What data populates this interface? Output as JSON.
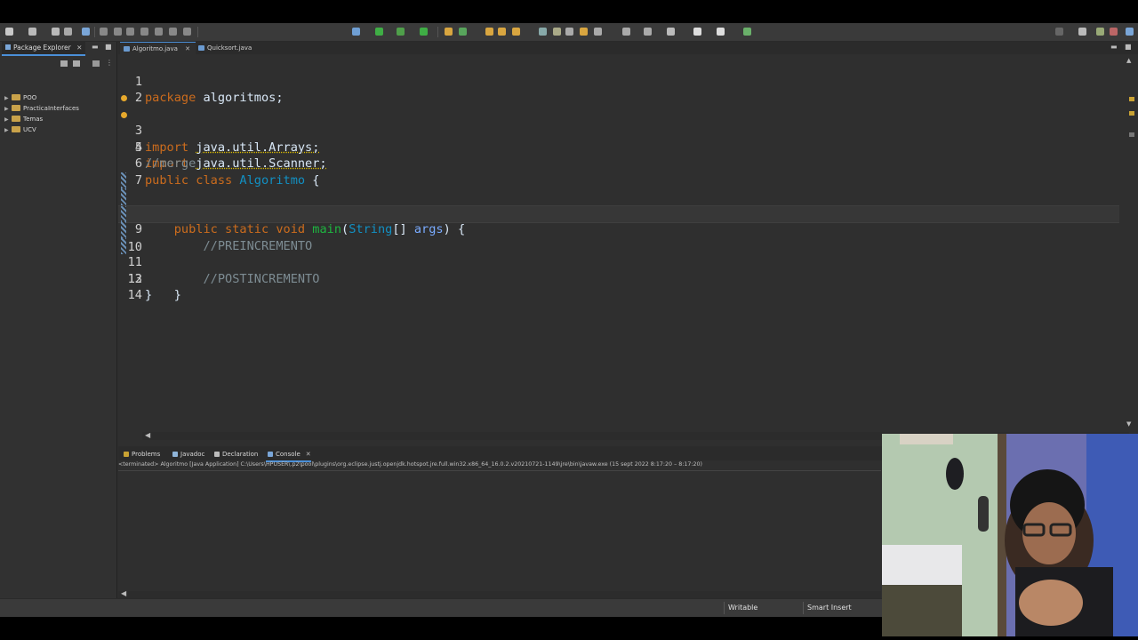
{
  "explorer": {
    "tab_label": "Package Explorer",
    "items": [
      {
        "label": "POO"
      },
      {
        "label": "PracticaInterfaces"
      },
      {
        "label": "Temas"
      },
      {
        "label": "UCV"
      }
    ]
  },
  "editor": {
    "tabs": [
      {
        "label": "Algoritmo.java",
        "active": true
      },
      {
        "label": "Quicksort.java",
        "active": false
      }
    ],
    "line_numbers": [
      "1",
      "2",
      "3",
      "4",
      "5",
      "6",
      "7",
      "8",
      "9",
      "10",
      "11",
      "12",
      "13",
      "14"
    ],
    "code": {
      "l1_kw": "package",
      "l1_rest": " algoritmos;",
      "l3_kw": "import",
      "l3_rest": "java.util.Arrays;",
      "l4_kw": "import",
      "l4_rest": "java.util.Scanner;",
      "l5_comment": "//merge",
      "l6_kw": "public class",
      "l6_cls": "Algoritmo",
      "l6_rest": " {",
      "l8_kw": "public static void",
      "l8_fn": "main",
      "l8_open": "(",
      "l8_type": "String",
      "l8_arr": "[] ",
      "l8_param": "args",
      "l8_close": ") {",
      "l9_comment": "//PREINCREMENTO",
      "l11_comment": "//POSTINCREMENTO",
      "l12_brace": "}",
      "l13_brace": "}"
    }
  },
  "console": {
    "tabs": [
      {
        "label": "Problems",
        "active": false
      },
      {
        "label": "Javadoc",
        "active": false
      },
      {
        "label": "Declaration",
        "active": false
      },
      {
        "label": "Console",
        "active": true
      }
    ],
    "header": "<terminated> Algoritmo [Java Application] C:\\Users\\HPUSER\\.p2\\pool\\plugins\\org.eclipse.justj.openjdk.hotspot.jre.full.win32.x86_64_16.0.2.v20210721-1149\\jre\\bin\\javaw.exe  (15 sept 2022 8:17:20 – 8:17:20)"
  },
  "statusbar": {
    "writable": "Writable",
    "insert_mode": "Smart Insert"
  },
  "colors": {
    "keyword": "#cc6c1d",
    "class": "#1290c3",
    "method": "#1eb540",
    "comment": "#7d8c93",
    "accent": "#4a8fd8"
  }
}
